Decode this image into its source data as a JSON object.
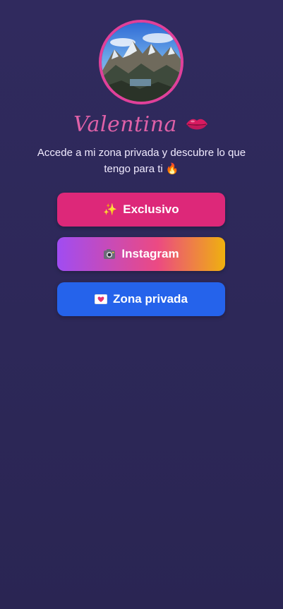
{
  "profile": {
    "name": "Valentina",
    "name_icon": "kiss-icon",
    "tagline": "Accede a mi zona privada y descubre lo que tengo para ti 🔥",
    "avatar_icon": "mountain-landscape-photo"
  },
  "buttons": [
    {
      "icon": "sparkles-icon",
      "icon_glyph": "✨",
      "label": "Exclusivo",
      "color": "#dd2879"
    },
    {
      "icon": "camera-icon",
      "icon_glyph": "📷",
      "label": "Instagram",
      "color": "#ec4a82"
    },
    {
      "icon": "heart-letter-icon",
      "icon_glyph": "💌",
      "label": "Zona privada",
      "color": "#2563eb"
    }
  ],
  "colors": {
    "background": "#2d2858",
    "accent": "#e061a8",
    "ring": "#e0409a"
  }
}
